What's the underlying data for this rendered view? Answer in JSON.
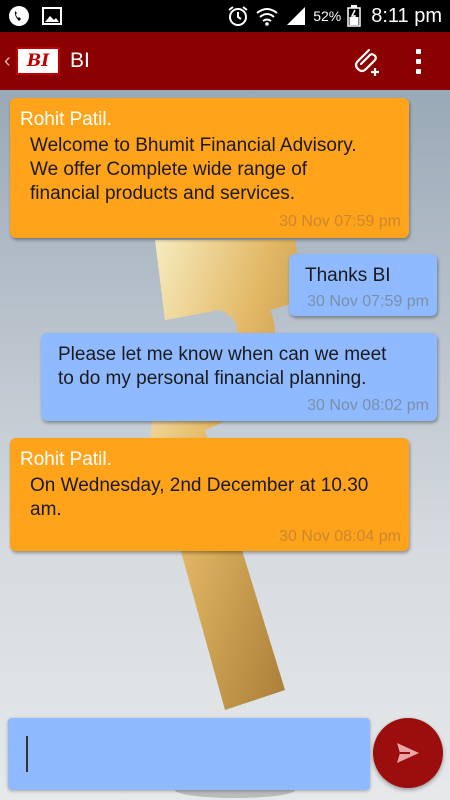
{
  "status_bar": {
    "battery": "52%",
    "time": "8:11 pm"
  },
  "app_bar": {
    "logo_text": "BI",
    "title": "BI"
  },
  "messages": [
    {
      "direction": "received",
      "sender": "Rohit Patil.",
      "lines": [
        "Welcome to Bhumit Financial Advisory.",
        "We offer Complete wide range of",
        "financial products and services."
      ],
      "timestamp": "30 Nov 07:59 pm"
    },
    {
      "direction": "sent",
      "lines": [
        "Thanks BI"
      ],
      "timestamp": "30 Nov 07:59 pm"
    },
    {
      "direction": "sent",
      "lines": [
        "Please let me know when can we meet",
        "to do my personal financial planning."
      ],
      "timestamp": "30 Nov 08:02 pm"
    },
    {
      "direction": "received",
      "sender": "Rohit Patil.",
      "lines": [
        "On Wednesday, 2nd December at 10.30",
        "am."
      ],
      "timestamp": "30 Nov 08:04 pm"
    }
  ],
  "composer": {
    "value": ""
  },
  "colors": {
    "app_bar": "#8b0000",
    "received_bubble": "#ffa31a",
    "sent_bubble": "#8fbaff",
    "send_button": "#9c0e0e"
  },
  "icons": {
    "status_left": [
      "phone-icon",
      "image-icon"
    ],
    "status_right": [
      "alarm-icon",
      "wifi-icon",
      "signal-icon",
      "battery-icon"
    ],
    "app_bar": [
      "back-chevron-icon",
      "attach-icon",
      "more-vert-icon"
    ],
    "composer": [
      "send-icon"
    ]
  }
}
